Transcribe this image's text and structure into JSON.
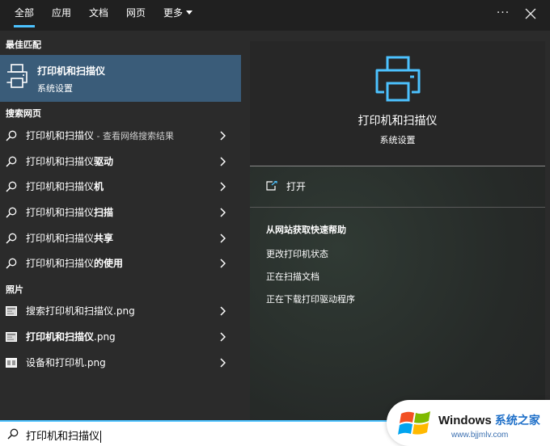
{
  "tabs": {
    "all": "全部",
    "apps": "应用",
    "documents": "文档",
    "web": "网页",
    "more": "更多"
  },
  "topbar": {
    "ellipsis": "···",
    "close_icon": "close-icon"
  },
  "sections": {
    "best_match": "最佳匹配",
    "web_search": "搜索网页",
    "photos": "照片"
  },
  "best_match": {
    "title": "打印机和扫描仪",
    "subtitle": "系统设置",
    "icon": "printer-icon"
  },
  "web_results": [
    {
      "bold": "",
      "text": "打印机和扫描仪",
      "suffix": " - 查看网络搜索结果"
    },
    {
      "bold": "驱动",
      "text": "打印机和扫描仪",
      "suffix": ""
    },
    {
      "bold": "机",
      "text": "打印机和扫描仪",
      "suffix": ""
    },
    {
      "bold": "扫描",
      "text": "打印机和扫描仪",
      "suffix": ""
    },
    {
      "bold": "共享",
      "text": "打印机和扫描仪",
      "suffix": ""
    },
    {
      "bold": "的使用",
      "text": "打印机和扫描仪",
      "suffix": ""
    }
  ],
  "photo_results": [
    {
      "prefix": "搜索",
      "main": "打印机和扫描仪",
      "ext": ".png",
      "bold": false
    },
    {
      "prefix": "",
      "main": "打印机和扫描仪",
      "ext": ".png",
      "bold": true
    },
    {
      "prefix": "设备和",
      "main": "打印机",
      "ext": ".png",
      "bold": false
    }
  ],
  "detail": {
    "title": "打印机和扫描仪",
    "subtitle": "系统设置",
    "open_label": "打开",
    "help_heading": "从网站获取快速帮助",
    "help_links": [
      "更改打印机状态",
      "正在扫描文档",
      "正在下载打印驱动程序"
    ]
  },
  "search": {
    "query": "打印机和扫描仪"
  },
  "watermark": {
    "brand": "Windows",
    "brand_cn": "系统之家",
    "url": "www.bjjmlv.com"
  },
  "colors": {
    "accent": "#4cc2ff",
    "selected_row": "#3a5c79",
    "background": "#2b2b2b",
    "topbar": "#202020"
  }
}
